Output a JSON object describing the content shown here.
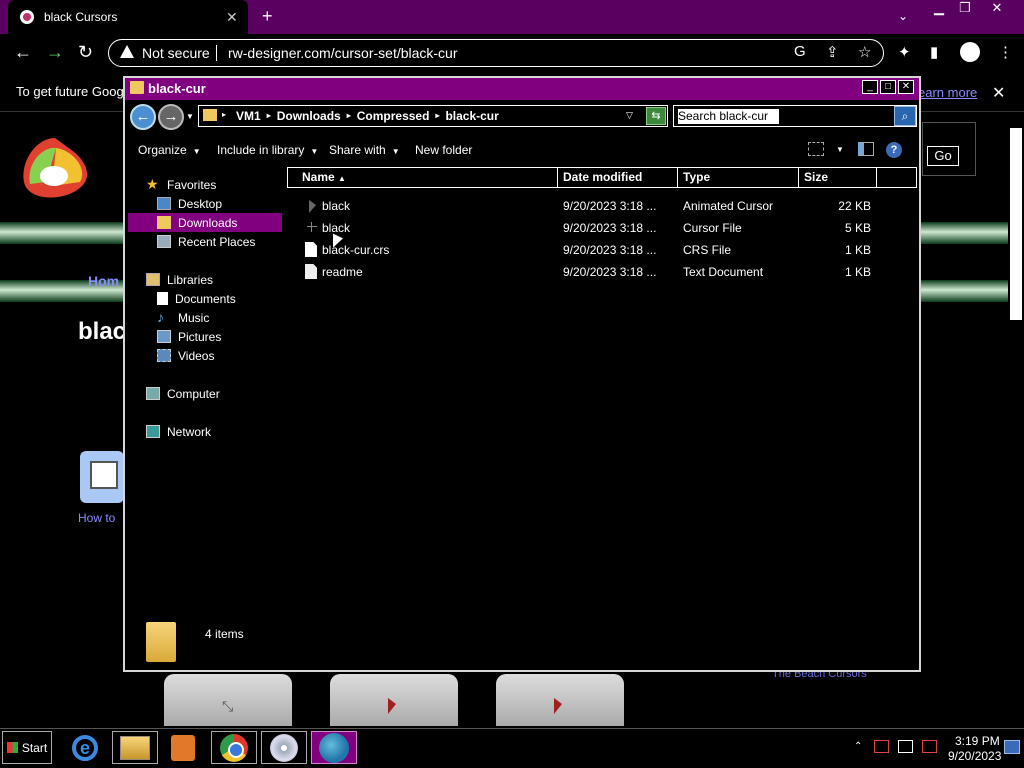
{
  "browser": {
    "tab_title": "black Cursors",
    "not_secure": "Not secure",
    "url": "rw-designer.com/cursor-set/black-cur",
    "infobar_text": "To get future Google",
    "learn_more": "earn more"
  },
  "page": {
    "home_link": "Hom",
    "heading": "blac",
    "howto": "How to",
    "go": "Go",
    "beach": "The Beach Cursors"
  },
  "explorer": {
    "title": "black-cur",
    "breadcrumb": [
      "VM1",
      "Downloads",
      "Compressed",
      "black-cur"
    ],
    "search_placeholder": "Search black-cur",
    "toolbar": {
      "organize": "Organize",
      "include": "Include in library",
      "share": "Share with",
      "new_folder": "New folder"
    },
    "nav": {
      "favorites": "Favorites",
      "desktop": "Desktop",
      "downloads": "Downloads",
      "recent": "Recent Places",
      "libraries": "Libraries",
      "documents": "Documents",
      "music": "Music",
      "pictures": "Pictures",
      "videos": "Videos",
      "computer": "Computer",
      "network": "Network"
    },
    "columns": {
      "name": "Name",
      "date": "Date modified",
      "type": "Type",
      "size": "Size"
    },
    "files": [
      {
        "name": "black",
        "date": "9/20/2023 3:18 ...",
        "type": "Animated Cursor",
        "size": "22 KB",
        "icon": "animated-cursor-icon"
      },
      {
        "name": "black",
        "date": "9/20/2023 3:18 ...",
        "type": "Cursor File",
        "size": "5 KB",
        "icon": "cursor-icon"
      },
      {
        "name": "black-cur.crs",
        "date": "9/20/2023 3:18 ...",
        "type": "CRS File",
        "size": "1 KB",
        "icon": "file-icon"
      },
      {
        "name": "readme",
        "date": "9/20/2023 3:18 ...",
        "type": "Text Document",
        "size": "1 KB",
        "icon": "text-file-icon"
      }
    ],
    "item_count": "4 items"
  },
  "taskbar": {
    "start": "Start",
    "time": "3:19 PM",
    "date": "9/20/2023"
  }
}
